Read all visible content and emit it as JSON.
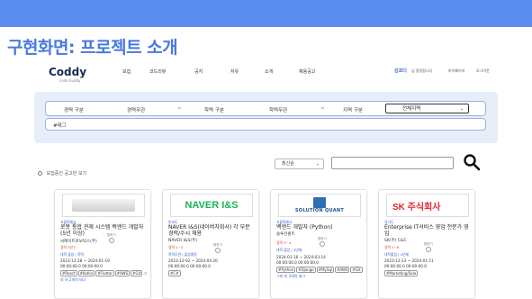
{
  "slide": {
    "title": "구현화면: 프로젝트 소개"
  },
  "nav": {
    "logo": "Coddy",
    "logo_sub": "code buddy",
    "menu": [
      "모집",
      "코드리뷰",
      "공지",
      "자유",
      "소개",
      "채용공고"
    ],
    "user_name": "김코디",
    "user_suffix": "님 환영합니다",
    "mypage": "마이페이지",
    "logout": "로그아웃"
  },
  "filter": {
    "labels": [
      "경력 구분",
      "경력무관",
      "~",
      "학력 구분",
      "학력무관",
      "~",
      "지역 구분"
    ],
    "region_value": "전체지역",
    "tag": "#태그"
  },
  "controls": {
    "sort_value": "최신순",
    "radio_label": "모집중인 공고만 보기"
  },
  "cards": [
    {
      "logo_text": "",
      "location": "서울특별시",
      "title": "로봇 통합 관제 시스템 백엔드 개발자 (5년 이상)",
      "company": "씨메이트로보틱스(주)",
      "pin_label": "찜하기",
      "line1": "경력 5년↑",
      "line2": "대학 졸업 | 학력",
      "dates": "2023-12-28 ~ 2024-01-19\n00:00:00.0 00:00:00.0",
      "tags": [
        "#React",
        "#Kotlin",
        "#Flutter",
        "#AWS",
        "#Git"
      ],
      "more": "그외 외 2개의 태그"
    },
    {
      "logo_text": "NAVER I&S",
      "location": "판교도",
      "title": "NAVER I&S(네이버자회사) 각 부문 경력/수시 채용",
      "company": "NAVER I&S(주)",
      "pin_label": "찜하기",
      "line1": "경력 1~5",
      "line2": "학력무관 | 졸업예정",
      "dates": "2023-12-02 ~ 2024-04-20\n00:00:00.0 00:00:00.0",
      "tags": [
        "#C#"
      ],
      "more": ""
    },
    {
      "logo_text": "SOLUTION QUANT",
      "location": "서울특별시",
      "title": "백엔드 개발자 (Python)",
      "company": "솔루션퀀트",
      "pin_label": "찜하기",
      "line1": "경력 3~4",
      "line2": "대학 졸업 | 4년제",
      "dates": "2024-01-16 ~ 2024-03-14\n00:00:00.0 00:00:00.0",
      "tags": [
        "#Python",
        "#Django",
        "#MySql",
        "#AWS",
        "#Git"
      ],
      "more": "그외 외 3개의 태그"
    },
    {
      "logo_text": "SK 주식회사",
      "location": "경기도",
      "title": "Enterprise IT서비스 영업 전문가 영입",
      "company": "SK(주) C&C",
      "pin_label": "찜하기",
      "line1": "경력 3~6",
      "line2": "대학졸업 | 4년제",
      "dates": "2023-12-23 ~ 2024-01-11\n00:00:00.0 00:00:00.0",
      "tags": [
        "#Marketing/Sale"
      ],
      "more": ""
    }
  ],
  "colors": {
    "accent": "#5b8def",
    "title": "#4a78e0",
    "filter_bg": "#e7eef9"
  }
}
